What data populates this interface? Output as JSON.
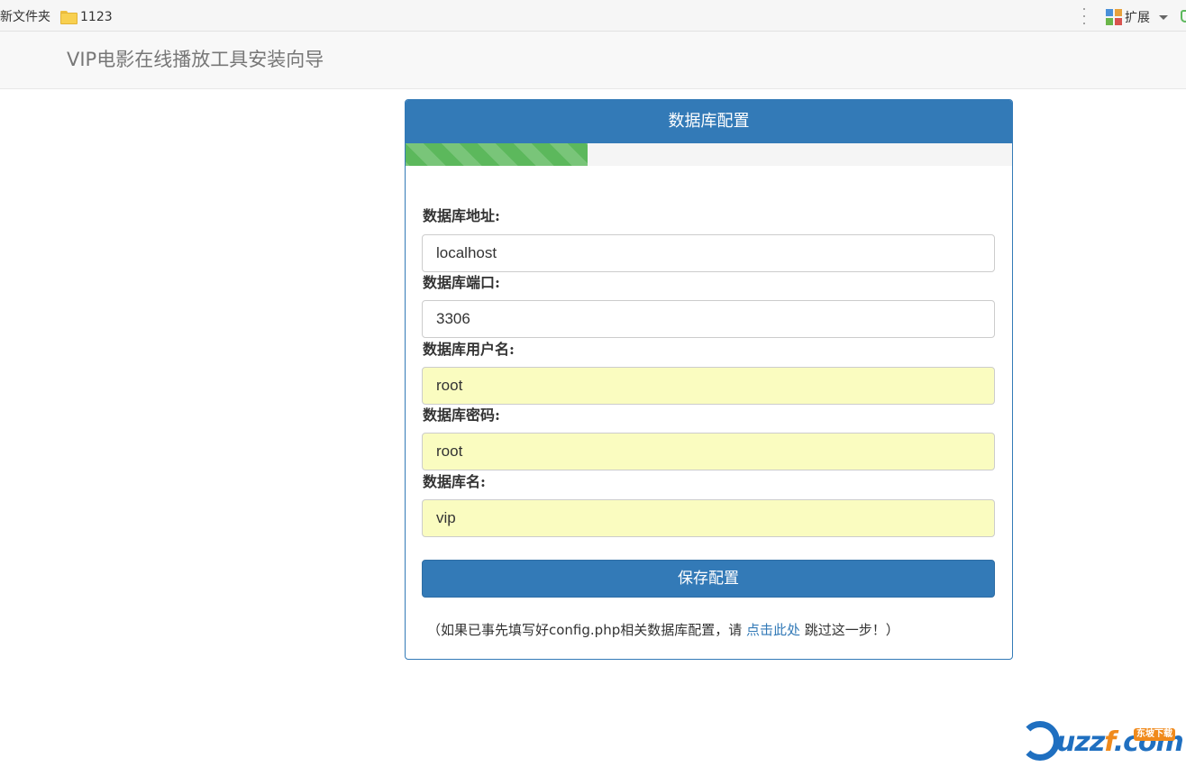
{
  "bookmarks": {
    "new_folder": "新文件夹",
    "folder_1123": "1123",
    "extensions": "扩展"
  },
  "navbar": {
    "brand": "VIP电影在线播放工具安装向导"
  },
  "panel": {
    "title": "数据库配置",
    "progress_percent": 30,
    "fields": {
      "host": {
        "label": "数据库地址:",
        "value": "localhost"
      },
      "port": {
        "label": "数据库端口:",
        "value": "3306"
      },
      "user": {
        "label": "数据库用户名:",
        "value": "root"
      },
      "password": {
        "label": "数据库密码:",
        "value": "root"
      },
      "dbname": {
        "label": "数据库名:",
        "value": "vip"
      }
    },
    "save_button": "保存配置",
    "hint": {
      "prefix": "（如果已事先填写好config.php相关数据库配置，请 ",
      "link": "点击此处",
      "suffix": " 跳过这一步！）"
    }
  },
  "watermark": {
    "text_uzz": "uzz",
    "text_f": "f",
    "text_com": ".com",
    "badge": "东坡下载"
  },
  "colors": {
    "primary": "#337ab7",
    "progress": "#5cb85c",
    "autofill": "#fafcc0"
  }
}
